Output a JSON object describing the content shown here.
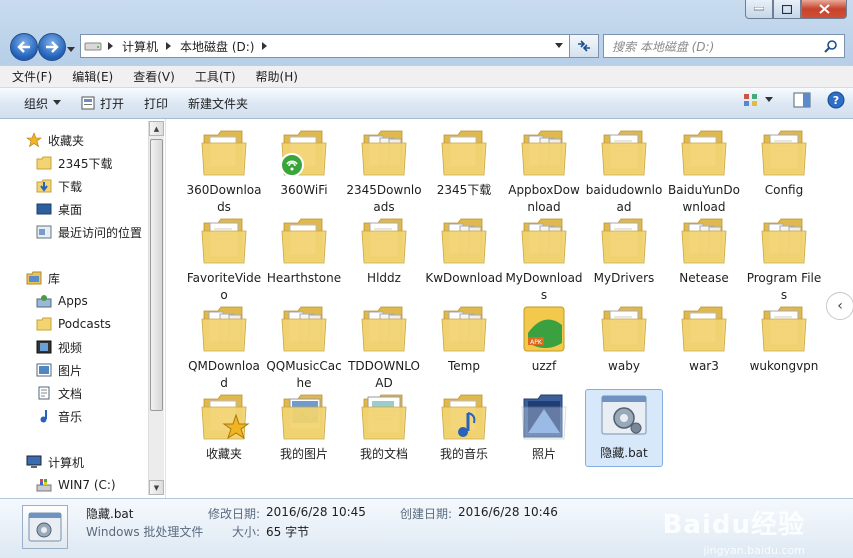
{
  "address": {
    "crumbs": [
      "计算机",
      "本地磁盘 (D:)"
    ]
  },
  "search": {
    "placeholder": "搜索 本地磁盘 (D:)"
  },
  "menu": [
    "文件(F)",
    "编辑(E)",
    "查看(V)",
    "工具(T)",
    "帮助(H)"
  ],
  "toolbar": {
    "organize": "组织",
    "open": "打开",
    "print": "打印",
    "new_folder": "新建文件夹"
  },
  "nav": {
    "favorites_header": "收藏夹",
    "favorites": [
      "2345下载",
      "下载",
      "桌面",
      "最近访问的位置"
    ],
    "library_header": "库",
    "libraries": [
      "Apps",
      "Podcasts",
      "视频",
      "图片",
      "文档",
      "音乐"
    ],
    "computer_header": "计算机",
    "drives": [
      "WIN7 (C:)"
    ]
  },
  "files": [
    {
      "name": "360Downloads",
      "type": "folder"
    },
    {
      "name": "360WiFi",
      "type": "folder-wifi"
    },
    {
      "name": "2345Downloads",
      "type": "folder-docs"
    },
    {
      "name": "2345下载",
      "type": "folder"
    },
    {
      "name": "AppboxDownload",
      "type": "folder-docs"
    },
    {
      "name": "baidudownload",
      "type": "folder-white"
    },
    {
      "name": "BaiduYunDownload",
      "type": "folder"
    },
    {
      "name": "Config",
      "type": "folder-white"
    },
    {
      "name": "FavoriteVideo",
      "type": "folder-white"
    },
    {
      "name": "Hearthstone",
      "type": "folder"
    },
    {
      "name": "Hlddz",
      "type": "folder-white"
    },
    {
      "name": "KwDownload",
      "type": "folder-docs"
    },
    {
      "name": "MyDownloads",
      "type": "folder-docs"
    },
    {
      "name": "MyDrivers",
      "type": "folder-white"
    },
    {
      "name": "Netease",
      "type": "folder-docs"
    },
    {
      "name": "Program Files",
      "type": "folder-docs"
    },
    {
      "name": "QMDownload",
      "type": "folder-docs"
    },
    {
      "name": "QQMusicCache",
      "type": "folder-docs"
    },
    {
      "name": "TDDOWNLOAD",
      "type": "folder-docs"
    },
    {
      "name": "Temp",
      "type": "folder-docs"
    },
    {
      "name": "uzzf",
      "type": "folder-apk"
    },
    {
      "name": "waby",
      "type": "folder-white"
    },
    {
      "name": "war3",
      "type": "folder"
    },
    {
      "name": "wukongvpn",
      "type": "folder-white"
    },
    {
      "name": "收藏夹",
      "type": "folder-star"
    },
    {
      "name": "我的图片",
      "type": "folder-pictures"
    },
    {
      "name": "我的文档",
      "type": "folder-documents"
    },
    {
      "name": "我的音乐",
      "type": "folder-music"
    },
    {
      "name": "照片",
      "type": "folder-photo"
    },
    {
      "name": "隐藏.bat",
      "type": "bat",
      "selected": true
    }
  ],
  "details": {
    "name": "隐藏.bat",
    "filetype": "Windows 批处理文件",
    "modified_label": "修改日期:",
    "modified": "2016/6/28 10:45",
    "size_label": "大小:",
    "size": "65 字节",
    "created_label": "创建日期:",
    "created": "2016/6/28 10:46"
  },
  "watermark": {
    "brand": "Baidu经验",
    "url": "jingyan.baidu.com"
  },
  "colors": {
    "folder": "#f2d472",
    "selection": "#d7e8fb",
    "nav_arrow": "#1f5fb8"
  }
}
